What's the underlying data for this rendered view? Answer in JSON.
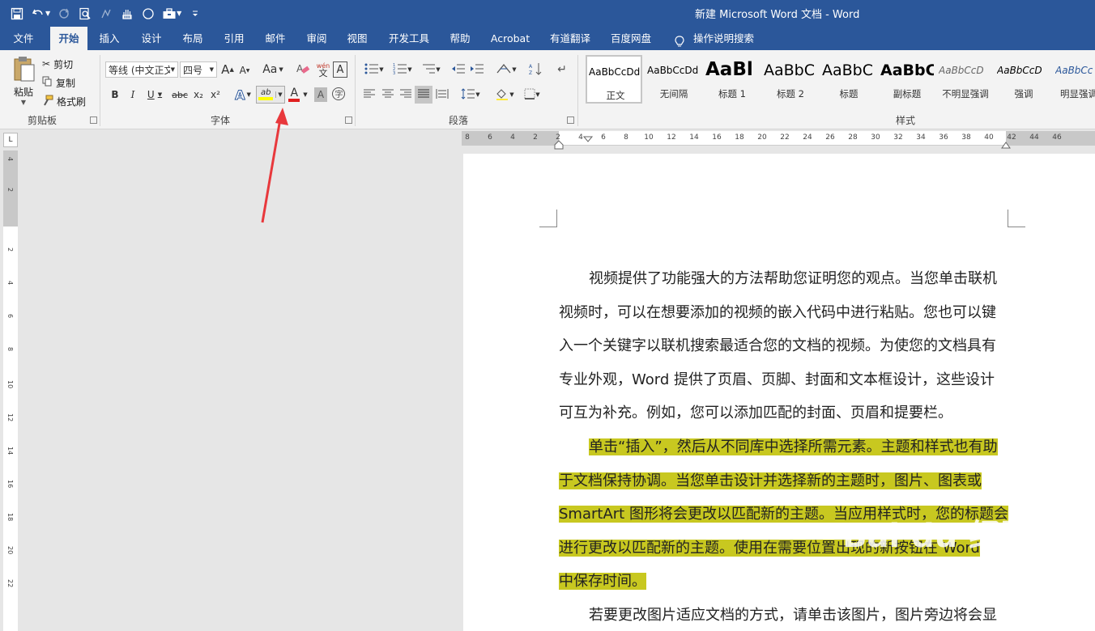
{
  "window": {
    "title": "新建 Microsoft Word 文档  -  Word"
  },
  "qat": {
    "icons": [
      "save-icon",
      "undo-icon",
      "redo-icon",
      "print-preview-icon",
      "touch-mode-icon",
      "hand-icon",
      "shape-icon",
      "toolbox-icon",
      "customize-qat-icon"
    ]
  },
  "tabs": [
    "文件",
    "开始",
    "插入",
    "设计",
    "布局",
    "引用",
    "邮件",
    "审阅",
    "视图",
    "开发工具",
    "帮助",
    "Acrobat",
    "有道翻译",
    "百度网盘",
    "操作说明搜索"
  ],
  "clipboard": {
    "paste": "粘贴",
    "cut": "剪切",
    "copy": "复制",
    "format_painter": "格式刷",
    "label": "剪贴板"
  },
  "font": {
    "name": "等线 (中文正文)",
    "size": "四号",
    "label": "字体",
    "bold": "B",
    "italic": "I",
    "underline": "U",
    "strike": "abc",
    "sub": "x₂",
    "sup": "x²",
    "grow": "A",
    "shrink": "A",
    "case": "Aa",
    "phonetic": "wén",
    "highlight": "ab",
    "font_color": "A",
    "shading": "A"
  },
  "paragraph": {
    "label": "段落"
  },
  "styles": {
    "label": "样式",
    "items": [
      {
        "sample": "AaBbCcDd",
        "name": "正文"
      },
      {
        "sample": "AaBbCcDd",
        "name": "无间隔"
      },
      {
        "sample": "AaBl",
        "name": "标题 1"
      },
      {
        "sample": "AaBbC",
        "name": "标题 2"
      },
      {
        "sample": "AaBbC",
        "name": "标题"
      },
      {
        "sample": "AaBbC",
        "name": "副标题"
      },
      {
        "sample": "AaBbCcD",
        "name": "不明显强调"
      },
      {
        "sample": "AaBbCcD",
        "name": "强调"
      },
      {
        "sample": "AaBbCc",
        "name": "明显强调"
      }
    ]
  },
  "ruler": {
    "h_ticks": [
      "8",
      "6",
      "4",
      "2",
      "2",
      "4",
      "6",
      "8",
      "10",
      "12",
      "14",
      "16",
      "18",
      "20",
      "22",
      "24",
      "26",
      "28",
      "30",
      "32",
      "34",
      "36",
      "38",
      "40",
      "42",
      "44",
      "46"
    ],
    "v_ticks": [
      "4",
      "2",
      "2",
      "4",
      "6",
      "8",
      "10",
      "12",
      "14",
      "16",
      "18",
      "20",
      "22"
    ]
  },
  "document": {
    "paragraphs": [
      {
        "lines": [
          "视频提供了功能强大的方法帮助您证明您的观点。当您单击联机",
          "视频时，可以在想要添加的视频的嵌入代码中进行粘贴。您也可以键",
          "入一个关键字以联机搜索最适合您的文档的视频。为使您的文档具有",
          "专业外观，Word 提供了页眉、页脚、封面和文本框设计，这些设计",
          "可互为补充。例如，您可以添加匹配的封面、页眉和提要栏。"
        ]
      },
      {
        "lines": [
          "单击“插入”，然后从不同库中选择所需元素。主题和样式也有助",
          "于文档保持协调。当您单击设计并选择新的主题时，图片、图表或",
          "SmartArt 图形将会更改以匹配新的主题。当应用样式时，您的标题会",
          "进行更改以匹配新的主题。使用在需要位置出现的新按钮在 Word",
          "中保存时间。"
        ]
      },
      {
        "lines": [
          "若要更改图片适应文档的方式，请单击该图片，图片旁边将会显"
        ]
      }
    ]
  },
  "watermark": {
    "text": "Bai du 经验",
    "sub": "jingyan.baidu.com"
  },
  "colors": {
    "accent": "#2b579a",
    "highlight": "#c8c820",
    "arrow": "#e8383c"
  }
}
